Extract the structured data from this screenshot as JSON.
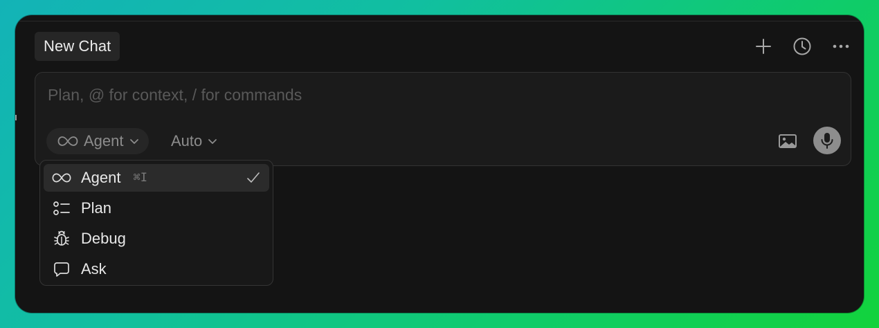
{
  "header": {
    "tab_label": "New Chat",
    "actions": [
      {
        "icon": "plus-icon"
      },
      {
        "icon": "history-clock-icon"
      },
      {
        "icon": "more-ellipsis-icon"
      }
    ]
  },
  "composer": {
    "placeholder": "Plan, @ for context, / for commands",
    "value": "",
    "mode_label": "Agent",
    "model_label": "Auto"
  },
  "mode_menu": {
    "items": [
      {
        "label": "Agent",
        "icon": "infinity-icon",
        "shortcut": "⌘I",
        "selected": true
      },
      {
        "label": "Plan",
        "icon": "plan-list-icon"
      },
      {
        "label": "Debug",
        "icon": "bug-icon"
      },
      {
        "label": "Ask",
        "icon": "chat-bubble-icon"
      }
    ]
  },
  "colors": {
    "window_bg": "#141414",
    "composer_bg": "#1b1b1b",
    "gradient_start": "#13b3b7",
    "gradient_end": "#12d23c"
  }
}
